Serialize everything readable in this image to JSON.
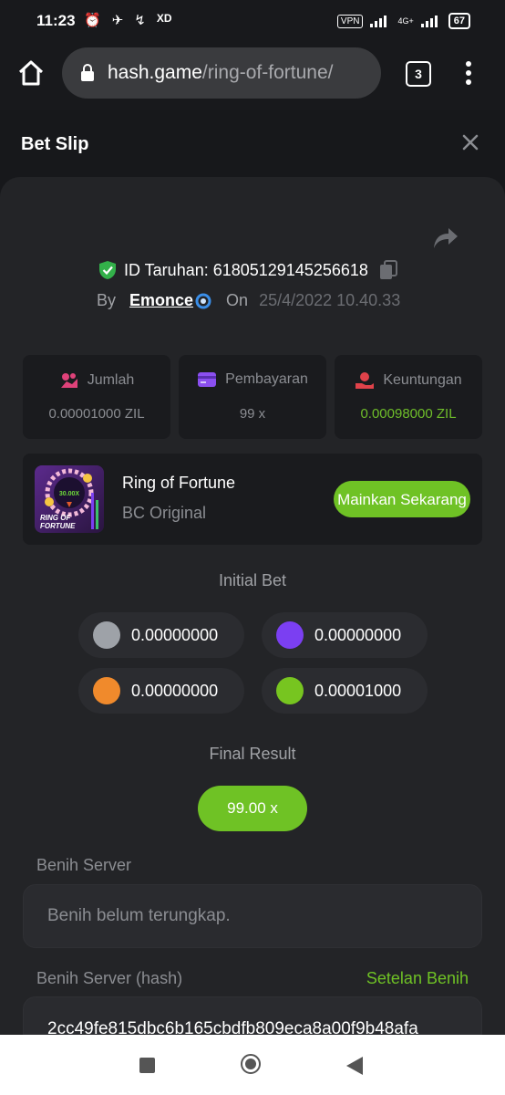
{
  "status_bar": {
    "time": "11:23",
    "icons": [
      "⏰",
      "✈",
      "↯",
      "XD"
    ],
    "vpn": "VPN",
    "network": "4G+",
    "battery": "67"
  },
  "browser": {
    "url_host": "hash.game",
    "url_path": "/ring-of-fortune/",
    "tab_count": "3"
  },
  "bet_slip": {
    "title": "Bet Slip",
    "id_label": "ID Taruhan: 61805129145256618",
    "by_label": "By",
    "username": "Emonce",
    "on_label": "On",
    "date": "25/4/2022 10.40.33"
  },
  "stats": [
    {
      "label": "Jumlah",
      "value": "0.00001000 ZIL",
      "icon": "coins-icon",
      "color": "#e0427a"
    },
    {
      "label": "Pembayaran",
      "value": "99 x",
      "icon": "card-icon",
      "color": "#8b4ff0"
    },
    {
      "label": "Keuntungan",
      "value": "0.00098000 ZIL",
      "icon": "hand-coin-icon",
      "color": "#e0424a"
    }
  ],
  "game": {
    "name": "Ring of Fortune",
    "subtitle": "BC Original",
    "play_label": "Mainkan Sekarang",
    "thumb_multiplier": "30.00X",
    "thumb_line1": "RING OF",
    "thumb_line2": "FORTUNE"
  },
  "initial_bet": {
    "title": "Initial Bet",
    "chips": [
      {
        "value": "0.00000000",
        "color": "#9ea2a8"
      },
      {
        "value": "0.00000000",
        "color": "#7b3ff2"
      },
      {
        "value": "0.00000000",
        "color": "#f08a2c"
      },
      {
        "value": "0.00001000",
        "color": "#77c520"
      }
    ]
  },
  "final_result": {
    "title": "Final Result",
    "value": "99.00 x"
  },
  "server_seed": {
    "label": "Benih Server",
    "placeholder": "Benih belum terungkap."
  },
  "server_seed_hash": {
    "label": "Benih Server (hash)",
    "link": "Setelan Benih",
    "value": "2cc49fe815dbc6b165cbdfb809eca8a00f9b48afa"
  }
}
